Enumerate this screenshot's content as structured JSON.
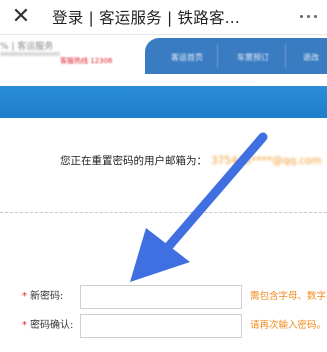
{
  "titlebar": {
    "close_icon": "✕",
    "title": "登录 | 客运服务 | 铁路客..."
  },
  "site_header": {
    "logo_text": "% | 客运服务",
    "hotline": "客服热线 12306",
    "nav_items": [
      "客运首页",
      "车票预订",
      "退改"
    ]
  },
  "info": {
    "prefix": "您正在重置密码的用户邮箱为：",
    "email": "375445****@qq.com"
  },
  "form": {
    "new_password": {
      "required_mark": "*",
      "label": "新密码:",
      "value": "",
      "hint": "需包含字母、数字、"
    },
    "confirm_password": {
      "required_mark": "*",
      "label": "密码确认:",
      "value": "",
      "hint": "请再次输入密码。"
    }
  },
  "colors": {
    "nav_blue": "#3a7cc1",
    "content_bar_blue": "#2a8dd8",
    "arrow_blue": "#3f6fe0",
    "hint_orange": "#f28a1e",
    "required_red": "#e0202a"
  }
}
